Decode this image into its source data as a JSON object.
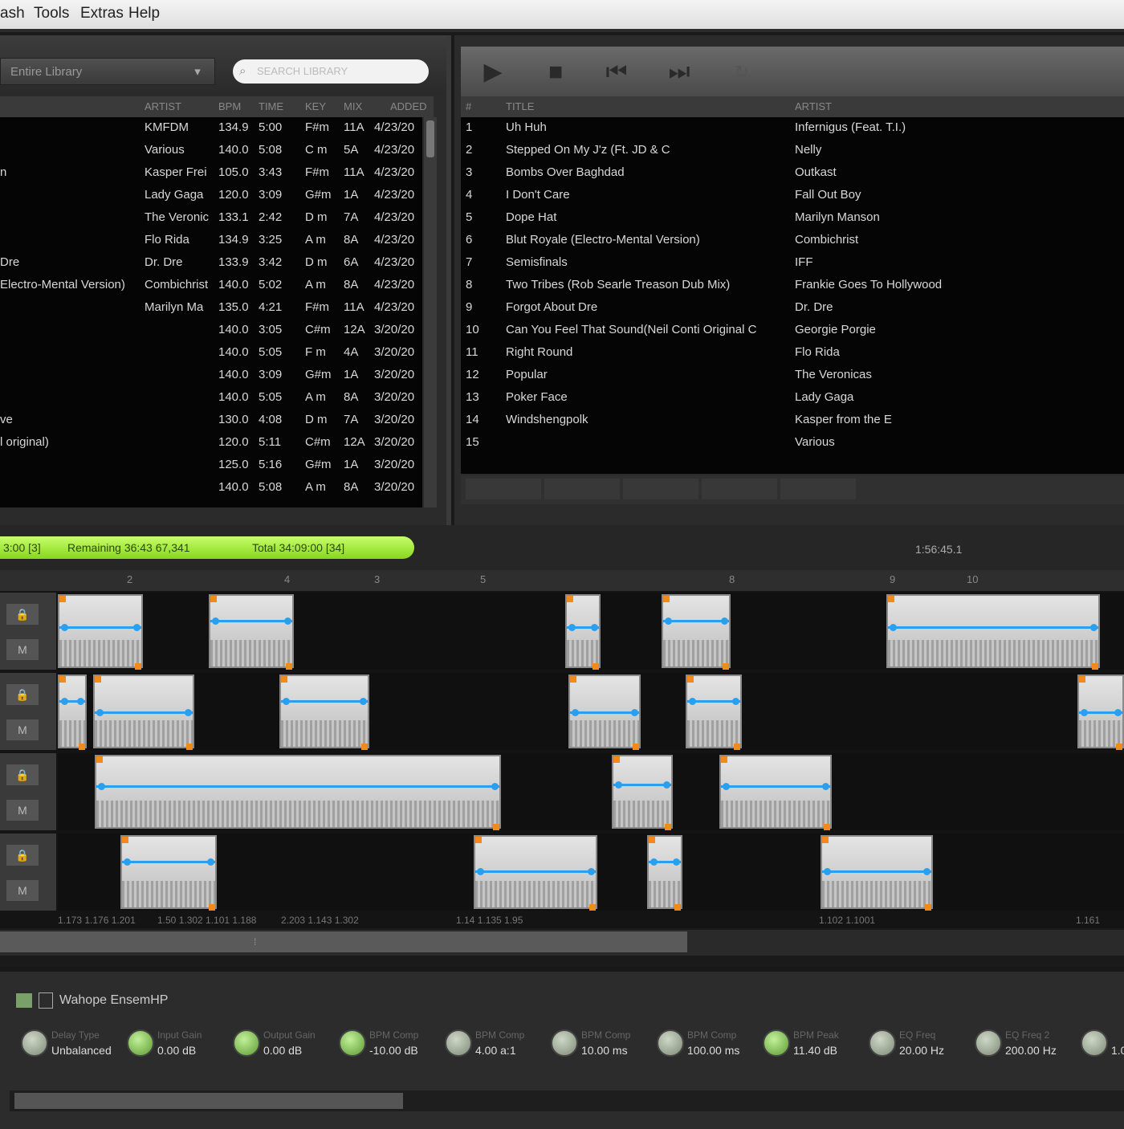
{
  "menu": [
    "ash",
    "Tools",
    "Extras",
    "Help"
  ],
  "library": {
    "selector": "Entire Library",
    "search_placeholder": "SEARCH LIBRARY",
    "columns": [
      "ARTIST",
      "BPM",
      "TIME",
      "KEY",
      "MIX",
      "ADDED"
    ],
    "rows": [
      {
        "title": "",
        "artist": "KMFDM",
        "bpm": "134.9",
        "time": "5:00",
        "key": "F#m",
        "mix": "11A",
        "added": "4/23/20"
      },
      {
        "title": "",
        "artist": "Various",
        "bpm": "140.0",
        "time": "5:08",
        "key": "C m",
        "mix": "5A",
        "added": "4/23/20"
      },
      {
        "title": "n",
        "artist": "Kasper Frei",
        "bpm": "105.0",
        "time": "3:43",
        "key": "F#m",
        "mix": "11A",
        "added": "4/23/20"
      },
      {
        "title": "",
        "artist": "Lady Gaga",
        "bpm": "120.0",
        "time": "3:09",
        "key": "G#m",
        "mix": "1A",
        "added": "4/23/20"
      },
      {
        "title": "",
        "artist": "The Veronic",
        "bpm": "133.1",
        "time": "2:42",
        "key": "D m",
        "mix": "7A",
        "added": "4/23/20"
      },
      {
        "title": "",
        "artist": "Flo Rida",
        "bpm": "134.9",
        "time": "3:25",
        "key": "A m",
        "mix": "8A",
        "added": "4/23/20"
      },
      {
        "title": "Dre",
        "artist": "Dr. Dre",
        "bpm": "133.9",
        "time": "3:42",
        "key": "D m",
        "mix": "6A",
        "added": "4/23/20"
      },
      {
        "title": "Electro-Mental Version)",
        "artist": "Combichrist",
        "bpm": "140.0",
        "time": "5:02",
        "key": "A m",
        "mix": "8A",
        "added": "4/23/20"
      },
      {
        "title": "",
        "artist": "Marilyn Ma",
        "bpm": "135.0",
        "time": "4:21",
        "key": "F#m",
        "mix": "11A",
        "added": "4/23/20"
      },
      {
        "title": "",
        "artist": "",
        "bpm": "140.0",
        "time": "3:05",
        "key": "C#m",
        "mix": "12A",
        "added": "3/20/20"
      },
      {
        "title": "",
        "artist": "",
        "bpm": "140.0",
        "time": "5:05",
        "key": "F m",
        "mix": "4A",
        "added": "3/20/20"
      },
      {
        "title": "",
        "artist": "",
        "bpm": "140.0",
        "time": "3:09",
        "key": "G#m",
        "mix": "1A",
        "added": "3/20/20"
      },
      {
        "title": "",
        "artist": "",
        "bpm": "140.0",
        "time": "5:05",
        "key": "A m",
        "mix": "8A",
        "added": "3/20/20"
      },
      {
        "title": "ve",
        "artist": "",
        "bpm": "130.0",
        "time": "4:08",
        "key": "D m",
        "mix": "7A",
        "added": "3/20/20"
      },
      {
        "title": "l original)",
        "artist": "",
        "bpm": "120.0",
        "time": "5:11",
        "key": "C#m",
        "mix": "12A",
        "added": "3/20/20"
      },
      {
        "title": "",
        "artist": "",
        "bpm": "125.0",
        "time": "5:16",
        "key": "G#m",
        "mix": "1A",
        "added": "3/20/20"
      },
      {
        "title": "",
        "artist": "",
        "bpm": "140.0",
        "time": "5:08",
        "key": "A m",
        "mix": "8A",
        "added": "3/20/20"
      }
    ]
  },
  "playlist": {
    "columns": [
      "#",
      "TITLE",
      "ARTIST"
    ],
    "rows": [
      {
        "num": "1",
        "title": "Uh Huh",
        "artist": "Infernigus (Feat. T.I.)"
      },
      {
        "num": "2",
        "title": "Stepped On My J'z (Ft. JD & C",
        "artist": "Nelly"
      },
      {
        "num": "3",
        "title": "Bombs Over Baghdad",
        "artist": "Outkast"
      },
      {
        "num": "4",
        "title": "I Don't Care",
        "artist": "Fall Out Boy"
      },
      {
        "num": "5",
        "title": "Dope Hat",
        "artist": "Marilyn Manson"
      },
      {
        "num": "6",
        "title": "Blut Royale (Electro-Mental Version)",
        "artist": "Combichrist"
      },
      {
        "num": "7",
        "title": "Semisfinals",
        "artist": "IFF"
      },
      {
        "num": "8",
        "title": "Two Tribes (Rob Searle Treason Dub Mix)",
        "artist": "Frankie Goes To Hollywood"
      },
      {
        "num": "9",
        "title": "Forgot About Dre",
        "artist": "Dr. Dre"
      },
      {
        "num": "10",
        "title": "Can You Feel That Sound(Neil Conti Original C",
        "artist": "Georgie Porgie"
      },
      {
        "num": "11",
        "title": "Right Round",
        "artist": "Flo Rida"
      },
      {
        "num": "12",
        "title": "Popular",
        "artist": "The Veronicas"
      },
      {
        "num": "13",
        "title": "Poker Face",
        "artist": "Lady Gaga"
      },
      {
        "num": "14",
        "title": "Windshengpolk",
        "artist": "Kasper from the E"
      },
      {
        "num": "15",
        "title": "",
        "artist": "Various"
      }
    ]
  },
  "timeline": {
    "pill": [
      "3:00 [3]",
      "Remaining 36:43 67,341",
      "Total 34:09:00 [34]"
    ],
    "zoom": "1:56:45.1",
    "ruler": [
      "2",
      "4",
      "3",
      "5",
      "8",
      "9",
      "10"
    ],
    "beat_labels": [
      "1.173 1.176 1.201",
      "1.50 1.302 1.101 1.188",
      "2.203 1.143 1.302",
      "1.14 1.135 1.95",
      "1.102 1.1001",
      "1.161"
    ]
  },
  "effects": {
    "title": "Wahope EnsemHP",
    "knobs": [
      {
        "label": "Delay Type",
        "value": "Unbalanced",
        "green": false
      },
      {
        "label": "Input Gain",
        "value": "0.00 dB",
        "green": true
      },
      {
        "label": "Output Gain",
        "value": "0.00 dB",
        "green": true
      },
      {
        "label": "BPM Comp",
        "value": "-10.00 dB",
        "green": true
      },
      {
        "label": "BPM Comp",
        "value": "4.00 a:1",
        "green": false
      },
      {
        "label": "BPM Comp",
        "value": "10.00 ms",
        "green": false
      },
      {
        "label": "BPM Comp",
        "value": "100.00 ms",
        "green": false
      },
      {
        "label": "BPM Peak",
        "value": "11.40 dB",
        "green": true
      },
      {
        "label": "EQ Freq",
        "value": "20.00 Hz",
        "green": false
      },
      {
        "label": "EQ Freq 2",
        "value": "200.00 Hz",
        "green": false
      },
      {
        "label": "",
        "value": "1.0",
        "green": false
      }
    ]
  }
}
